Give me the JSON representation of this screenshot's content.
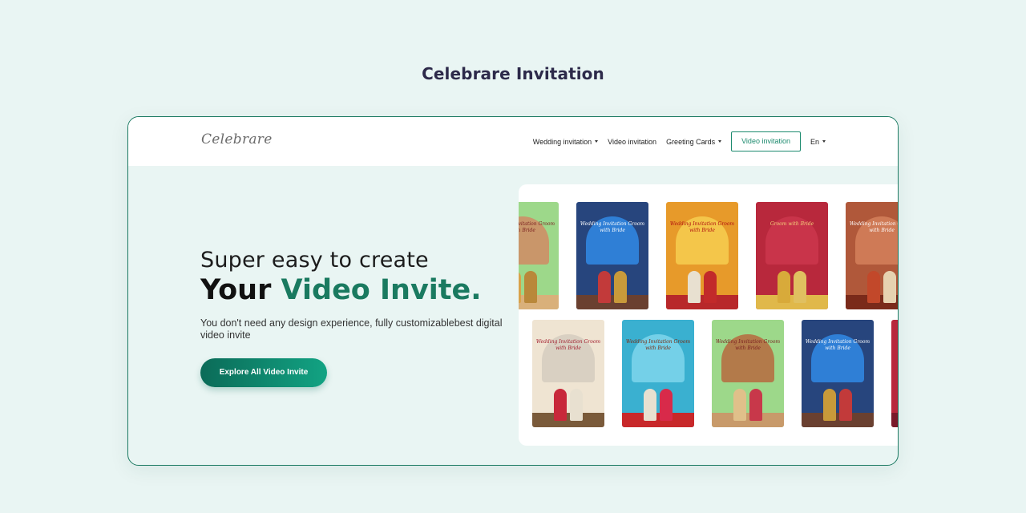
{
  "page": {
    "title": "Celebrare Invitation"
  },
  "navbar": {
    "logo": "Celebrare",
    "items": [
      {
        "label": "Wedding invitation",
        "dropdown": true
      },
      {
        "label": "Video invitation",
        "dropdown": false
      },
      {
        "label": "Greeting Cards",
        "dropdown": true
      }
    ],
    "button_label": "Video invitation",
    "language": "En"
  },
  "hero": {
    "subtitle": "Super easy to create",
    "title_prefix": "Your ",
    "title_accent": "Video Invite.",
    "description": "You don't need any design experience, fully customizablebest digital video invite",
    "cta_label": "Explore All Video Invite"
  },
  "colors": {
    "accent": "#1a7a60",
    "border": "#1c7a62",
    "background": "#e9f5f3",
    "title": "#2d2a4a"
  },
  "gallery": {
    "cards": [
      {
        "name": "card-green-arch-partial",
        "bg": "#9dd88a",
        "arch": "#c9966a",
        "text_color": "#7a2020",
        "floor": "#d9b07a",
        "p1": "#d9a24a",
        "p2": "#b9883a",
        "text": "Wedding Invitation Groom with Bride"
      },
      {
        "name": "card-blue-temple",
        "bg": "#27457d",
        "arch": "#2f7fd6",
        "text_color": "#ffffff",
        "floor": "#6a4030",
        "p1": "#c23a3a",
        "p2": "#c89a3a",
        "text": "Wedding Invitation Groom with Bride"
      },
      {
        "name": "card-red-curtain",
        "bg": "#e79a2a",
        "arch": "#f4c64a",
        "text_color": "#b01010",
        "floor": "#b8282a",
        "p1": "#e8e0d0",
        "p2": "#c22a2a",
        "text": "Wedding Invitation Groom with Bride"
      },
      {
        "name": "card-ganesha-maroon",
        "bg": "#b8283c",
        "arch": "#c9344a",
        "text_color": "#f3d27a",
        "floor": "#e0b84a",
        "p1": "#d8aa3a",
        "p2": "#e0c060",
        "text": "Groom with Bride"
      },
      {
        "name": "card-brown-partial",
        "bg": "#b0583a",
        "arch": "#cf7a56",
        "text_color": "#ffffff",
        "floor": "#7a2a1a",
        "p1": "#c2482a",
        "p2": "#e6d2b0",
        "text": "Wedding Invitation Groom with Bride"
      },
      {
        "name": "card-taj-mahal",
        "bg": "#efe4d2",
        "arch": "#d9d0c2",
        "text_color": "#a01c2c",
        "floor": "#7a5a3a",
        "p1": "#c8283a",
        "p2": "#e8e0d0",
        "text": "Wedding Invitation Groom with Bride"
      },
      {
        "name": "card-beach",
        "bg": "#3ab0d0",
        "arch": "#74d0e8",
        "text_color": "#7a2a10",
        "floor": "#c8282a",
        "p1": "#e8e0d0",
        "p2": "#d82a4a",
        "text": "Wedding Invitation Groom with Bride"
      },
      {
        "name": "card-green-arch",
        "bg": "#9dd88a",
        "arch": "#b37a4a",
        "text_color": "#7a2020",
        "floor": "#c89a6a",
        "p1": "#e0c08a",
        "p2": "#c8384a",
        "text": "Wedding Invitation Groom with Bride"
      },
      {
        "name": "card-blue-temple-2",
        "bg": "#27457d",
        "arch": "#2f7fd6",
        "text_color": "#ffffff",
        "floor": "#6a4030",
        "p1": "#c89a3a",
        "p2": "#c23a3a",
        "text": "Wedding Invitation Groom with Bride"
      },
      {
        "name": "card-red-partial",
        "bg": "#b8283c",
        "arch": "#e07a2a",
        "text_color": "#ffffff",
        "floor": "#7a1a2a",
        "p1": "#e0c060",
        "p2": "#c23a3a",
        "text": ""
      }
    ]
  }
}
